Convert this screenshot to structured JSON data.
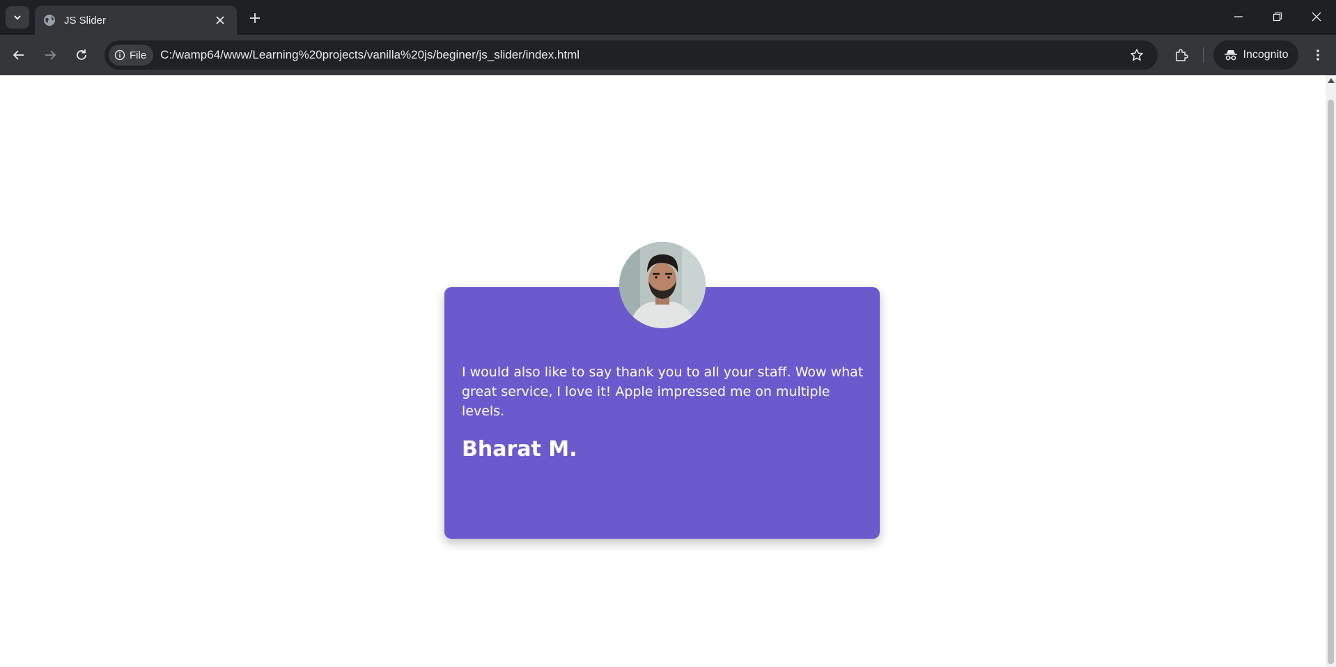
{
  "browser": {
    "tab_title": "JS Slider",
    "site_chip": "File",
    "url": "C:/wamp64/www/Learning%20projects/vanilla%20js/beginer/js_slider/index.html",
    "profile_label": "Incognito",
    "icons": [
      "tab-search-icon",
      "globe-icon",
      "close-icon",
      "plus-icon",
      "minimize-icon",
      "restore-icon",
      "window-close-icon",
      "back-arrow-icon",
      "forward-arrow-icon",
      "reload-icon",
      "info-icon",
      "star-icon",
      "extensions-icon",
      "incognito-icon",
      "kebab-menu-icon"
    ]
  },
  "testimonial": {
    "quote": "I would also like to say thank you to all your staff. Wow what great service, I love it! Apple impressed me on multiple levels.",
    "author": "Bharat M.",
    "avatar_icon": "person-photo",
    "card_color": "#6a5acd"
  }
}
